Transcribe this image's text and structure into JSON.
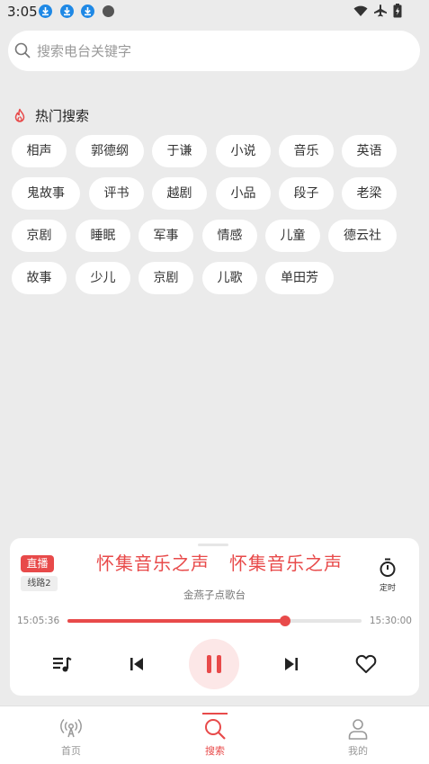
{
  "status_bar": {
    "time": "3:05"
  },
  "search": {
    "placeholder": "搜索电台关键字"
  },
  "hot_search": {
    "title": "热门搜索",
    "rows": [
      [
        "相声",
        "郭德纲",
        "于谦",
        "小说",
        "音乐",
        "英语"
      ],
      [
        "鬼故事",
        "评书",
        "越剧",
        "小品",
        "段子",
        "老梁"
      ],
      [
        "京剧",
        "睡眠",
        "军事",
        "情感",
        "儿童",
        "德云社"
      ],
      [
        "故事",
        "少儿",
        "京剧",
        "儿歌",
        "单田芳"
      ]
    ]
  },
  "player": {
    "live_badge": "直播",
    "line_badge": "线路2",
    "title_left": "怀集音乐之声",
    "title_right": "怀集音乐之声",
    "station": "金燕子点歌台",
    "timer_label": "定时",
    "time_start": "15:05:36",
    "time_end": "15:30:00",
    "progress": 0.74
  },
  "bottom_nav": {
    "items": [
      {
        "label": "首页",
        "icon": "radio-icon",
        "active": false
      },
      {
        "label": "搜索",
        "icon": "search-icon",
        "active": true
      },
      {
        "label": "我的",
        "icon": "profile-icon",
        "active": false
      }
    ]
  },
  "colors": {
    "accent": "#e84a4a",
    "background": "#ebebeb",
    "card": "#ffffff"
  }
}
